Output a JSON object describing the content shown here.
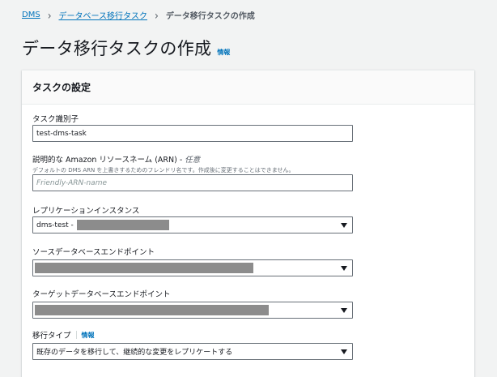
{
  "breadcrumb": {
    "items": [
      "DMS",
      "データベース移行タスク"
    ],
    "current": "データ移行タスクの作成"
  },
  "header": {
    "title": "データ移行タスクの作成",
    "info": "情報"
  },
  "panel": {
    "title": "タスクの設定",
    "task_id": {
      "label": "タスク識別子",
      "value": "test-dms-task"
    },
    "arn": {
      "label": "説明的な Amazon リソースネーム (ARN) -",
      "optional": "任意",
      "description": "デフォルトの DMS ARN を上書きするためのフレンドリ名です。作成後に変更することはできません。",
      "placeholder": "Friendly-ARN-name"
    },
    "replication_instance": {
      "label": "レプリケーションインスタンス",
      "value": "dms-test -"
    },
    "source_endpoint": {
      "label": "ソースデータベースエンドポイント"
    },
    "target_endpoint": {
      "label": "ターゲットデータベースエンドポイント"
    },
    "migration_type": {
      "label": "移行タイプ",
      "info": "情報",
      "value": "既存のデータを移行して、継続的な変更をレプリケートする"
    }
  },
  "colors": {
    "link": "#0073bb",
    "background": "#f2f3f3",
    "redaction": "#8c8c8c"
  }
}
